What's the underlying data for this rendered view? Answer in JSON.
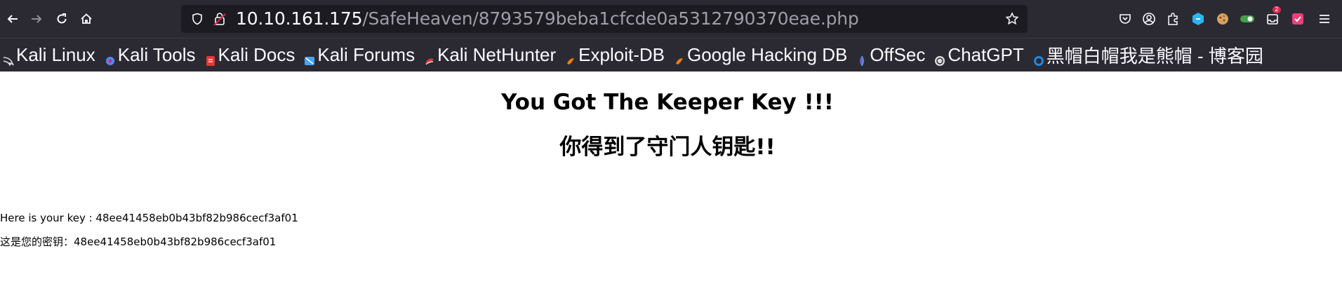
{
  "browser": {
    "url_host": "10.10.161.175",
    "url_path": "/SafeHeaven/8793579beba1cfcde0a5312790370eae.php",
    "notification_count": "2"
  },
  "bookmarks": [
    {
      "label": "Kali Linux",
      "icon": "kali-dragon-icon",
      "color": "#e0e0e0"
    },
    {
      "label": "Kali Tools",
      "icon": "kali-tools-icon",
      "color": "#4c8bf5"
    },
    {
      "label": "Kali Docs",
      "icon": "kali-docs-icon",
      "color": "#e53935"
    },
    {
      "label": "Kali Forums",
      "icon": "kali-forums-icon",
      "color": "#42a5f5"
    },
    {
      "label": "Kali NetHunter",
      "icon": "nethunter-icon",
      "color": "#e53935"
    },
    {
      "label": "Exploit-DB",
      "icon": "exploit-db-icon",
      "color": "#f57c00"
    },
    {
      "label": "Google Hacking DB",
      "icon": "ghdb-icon",
      "color": "#f57c00"
    },
    {
      "label": "OffSec",
      "icon": "offsec-icon",
      "color": "#7e57c2"
    },
    {
      "label": "ChatGPT",
      "icon": "chatgpt-icon",
      "color": "#e0e0e0"
    },
    {
      "label": "黑帽白帽我是熊帽 - 博客园",
      "icon": "cnblogs-icon",
      "color": "#1e88e5"
    }
  ],
  "page": {
    "heading_en": "You Got The Keeper Key !!!",
    "heading_zh": "你得到了守门人钥匙!!",
    "key_line_en": "Here is your key : 48ee41458eb0b43bf82b986cecf3af01",
    "key_line_zh": "这是您的密钥：48ee41458eb0b43bf82b986cecf3af01"
  }
}
